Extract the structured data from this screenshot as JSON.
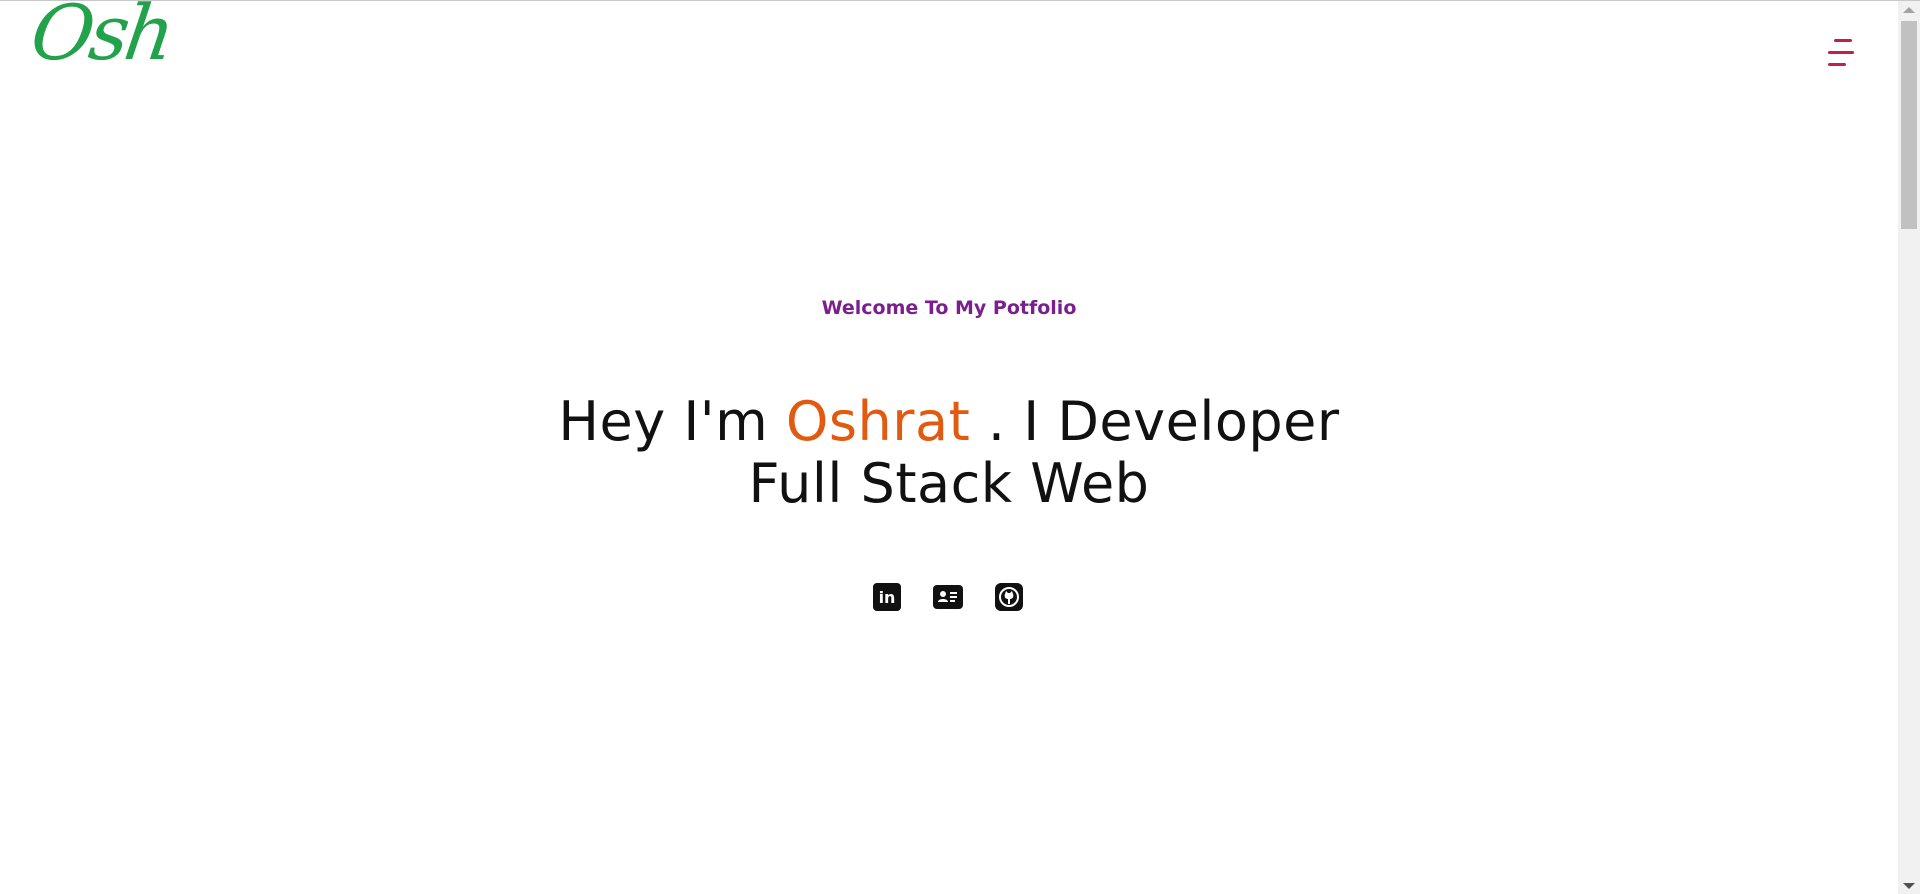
{
  "header": {
    "logo_text": "Osh",
    "menu_icon": "hamburger-menu-icon"
  },
  "hero": {
    "welcome": "Welcome To My Potfolio",
    "headline_prefix": "Hey I'm ",
    "headline_name": "Oshrat",
    "headline_suffix": " . I Developer",
    "headline_line2": "Full Stack Web"
  },
  "socials": [
    {
      "icon": "linkedin-icon",
      "glyph": "in"
    },
    {
      "icon": "contact-card-icon"
    },
    {
      "icon": "github-icon"
    }
  ],
  "colors": {
    "logo": "#22a24a",
    "menu": "#c41e4c",
    "welcome": "#7b1f8f",
    "name_accent": "#e25a12",
    "text": "#111111"
  }
}
